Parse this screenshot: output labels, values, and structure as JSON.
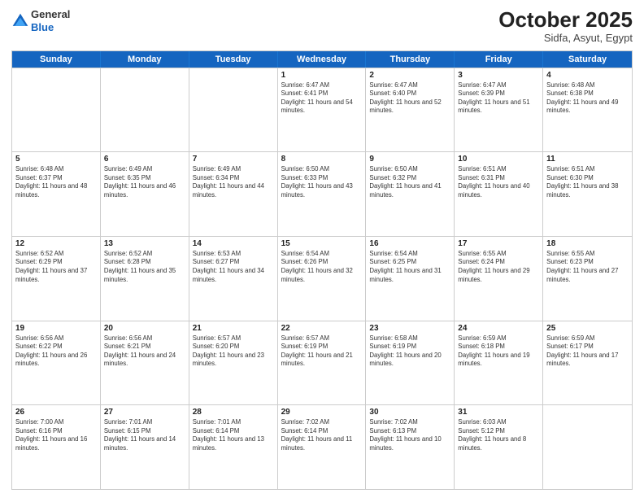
{
  "logo": {
    "general": "General",
    "blue": "Blue"
  },
  "header": {
    "month": "October 2025",
    "location": "Sidfa, Asyut, Egypt"
  },
  "days_of_week": [
    "Sunday",
    "Monday",
    "Tuesday",
    "Wednesday",
    "Thursday",
    "Friday",
    "Saturday"
  ],
  "weeks": [
    [
      {
        "day": "",
        "info": ""
      },
      {
        "day": "",
        "info": ""
      },
      {
        "day": "",
        "info": ""
      },
      {
        "day": "1",
        "info": "Sunrise: 6:47 AM\nSunset: 6:41 PM\nDaylight: 11 hours and 54 minutes."
      },
      {
        "day": "2",
        "info": "Sunrise: 6:47 AM\nSunset: 6:40 PM\nDaylight: 11 hours and 52 minutes."
      },
      {
        "day": "3",
        "info": "Sunrise: 6:47 AM\nSunset: 6:39 PM\nDaylight: 11 hours and 51 minutes."
      },
      {
        "day": "4",
        "info": "Sunrise: 6:48 AM\nSunset: 6:38 PM\nDaylight: 11 hours and 49 minutes."
      }
    ],
    [
      {
        "day": "5",
        "info": "Sunrise: 6:48 AM\nSunset: 6:37 PM\nDaylight: 11 hours and 48 minutes."
      },
      {
        "day": "6",
        "info": "Sunrise: 6:49 AM\nSunset: 6:35 PM\nDaylight: 11 hours and 46 minutes."
      },
      {
        "day": "7",
        "info": "Sunrise: 6:49 AM\nSunset: 6:34 PM\nDaylight: 11 hours and 44 minutes."
      },
      {
        "day": "8",
        "info": "Sunrise: 6:50 AM\nSunset: 6:33 PM\nDaylight: 11 hours and 43 minutes."
      },
      {
        "day": "9",
        "info": "Sunrise: 6:50 AM\nSunset: 6:32 PM\nDaylight: 11 hours and 41 minutes."
      },
      {
        "day": "10",
        "info": "Sunrise: 6:51 AM\nSunset: 6:31 PM\nDaylight: 11 hours and 40 minutes."
      },
      {
        "day": "11",
        "info": "Sunrise: 6:51 AM\nSunset: 6:30 PM\nDaylight: 11 hours and 38 minutes."
      }
    ],
    [
      {
        "day": "12",
        "info": "Sunrise: 6:52 AM\nSunset: 6:29 PM\nDaylight: 11 hours and 37 minutes."
      },
      {
        "day": "13",
        "info": "Sunrise: 6:52 AM\nSunset: 6:28 PM\nDaylight: 11 hours and 35 minutes."
      },
      {
        "day": "14",
        "info": "Sunrise: 6:53 AM\nSunset: 6:27 PM\nDaylight: 11 hours and 34 minutes."
      },
      {
        "day": "15",
        "info": "Sunrise: 6:54 AM\nSunset: 6:26 PM\nDaylight: 11 hours and 32 minutes."
      },
      {
        "day": "16",
        "info": "Sunrise: 6:54 AM\nSunset: 6:25 PM\nDaylight: 11 hours and 31 minutes."
      },
      {
        "day": "17",
        "info": "Sunrise: 6:55 AM\nSunset: 6:24 PM\nDaylight: 11 hours and 29 minutes."
      },
      {
        "day": "18",
        "info": "Sunrise: 6:55 AM\nSunset: 6:23 PM\nDaylight: 11 hours and 27 minutes."
      }
    ],
    [
      {
        "day": "19",
        "info": "Sunrise: 6:56 AM\nSunset: 6:22 PM\nDaylight: 11 hours and 26 minutes."
      },
      {
        "day": "20",
        "info": "Sunrise: 6:56 AM\nSunset: 6:21 PM\nDaylight: 11 hours and 24 minutes."
      },
      {
        "day": "21",
        "info": "Sunrise: 6:57 AM\nSunset: 6:20 PM\nDaylight: 11 hours and 23 minutes."
      },
      {
        "day": "22",
        "info": "Sunrise: 6:57 AM\nSunset: 6:19 PM\nDaylight: 11 hours and 21 minutes."
      },
      {
        "day": "23",
        "info": "Sunrise: 6:58 AM\nSunset: 6:19 PM\nDaylight: 11 hours and 20 minutes."
      },
      {
        "day": "24",
        "info": "Sunrise: 6:59 AM\nSunset: 6:18 PM\nDaylight: 11 hours and 19 minutes."
      },
      {
        "day": "25",
        "info": "Sunrise: 6:59 AM\nSunset: 6:17 PM\nDaylight: 11 hours and 17 minutes."
      }
    ],
    [
      {
        "day": "26",
        "info": "Sunrise: 7:00 AM\nSunset: 6:16 PM\nDaylight: 11 hours and 16 minutes."
      },
      {
        "day": "27",
        "info": "Sunrise: 7:01 AM\nSunset: 6:15 PM\nDaylight: 11 hours and 14 minutes."
      },
      {
        "day": "28",
        "info": "Sunrise: 7:01 AM\nSunset: 6:14 PM\nDaylight: 11 hours and 13 minutes."
      },
      {
        "day": "29",
        "info": "Sunrise: 7:02 AM\nSunset: 6:14 PM\nDaylight: 11 hours and 11 minutes."
      },
      {
        "day": "30",
        "info": "Sunrise: 7:02 AM\nSunset: 6:13 PM\nDaylight: 11 hours and 10 minutes."
      },
      {
        "day": "31",
        "info": "Sunrise: 6:03 AM\nSunset: 5:12 PM\nDaylight: 11 hours and 8 minutes."
      },
      {
        "day": "",
        "info": ""
      }
    ]
  ]
}
